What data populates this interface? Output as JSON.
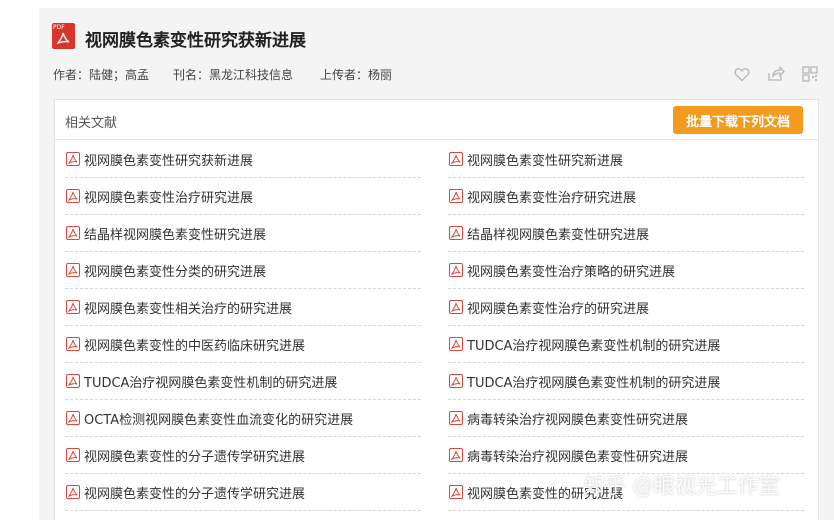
{
  "document": {
    "title": "视网膜色素变性研究获新进展",
    "author": "作者：陆健；高孟",
    "journal": "刊名：黑龙江科技信息",
    "uploader": "上传者：杨丽",
    "logo_text": "PDF"
  },
  "actions": {
    "like_icon": "heart-icon",
    "share_icon": "share-icon",
    "qr_icon": "qrcode-icon",
    "report_icon": "warning-icon"
  },
  "related": {
    "label": "相关文献",
    "batch_button": "批量下载下列文档",
    "left": [
      "视网膜色素变性研究获新进展",
      "视网膜色素变性治疗研究进展",
      "结晶样视网膜色素变性研究进展",
      "视网膜色素变性分类的研究进展",
      "视网膜色素变性相关治疗的研究进展",
      "视网膜色素变性的中医药临床研究进展",
      "TUDCA治疗视网膜色素变性机制的研究进展",
      "OCTA检测视网膜色素变性血流变化的研究进展",
      "视网膜色素变性的分子遗传学研究进展",
      "视网膜色素变性的分子遗传学研究进展"
    ],
    "right": [
      "视网膜色素变性研究新进展",
      "视网膜色素变性治疗研究进展",
      "结晶样视网膜色素变性研究进展",
      "视网膜色素变性治疗策略的研究进展",
      "视网膜色素变性治疗的研究进展",
      "TUDCA治疗视网膜色素变性机制的研究进展",
      "TUDCA治疗视网膜色素变性机制的研究进展",
      "病毒转染治疗视网膜色素变性研究进展",
      "病毒转染治疗视网膜色素变性研究进展",
      "视网膜色素变性的研究进展"
    ]
  },
  "watermark": "知乎 @眼视光工作室",
  "colors": {
    "accent": "#f39a21",
    "pdf_red": "#d9352b"
  }
}
